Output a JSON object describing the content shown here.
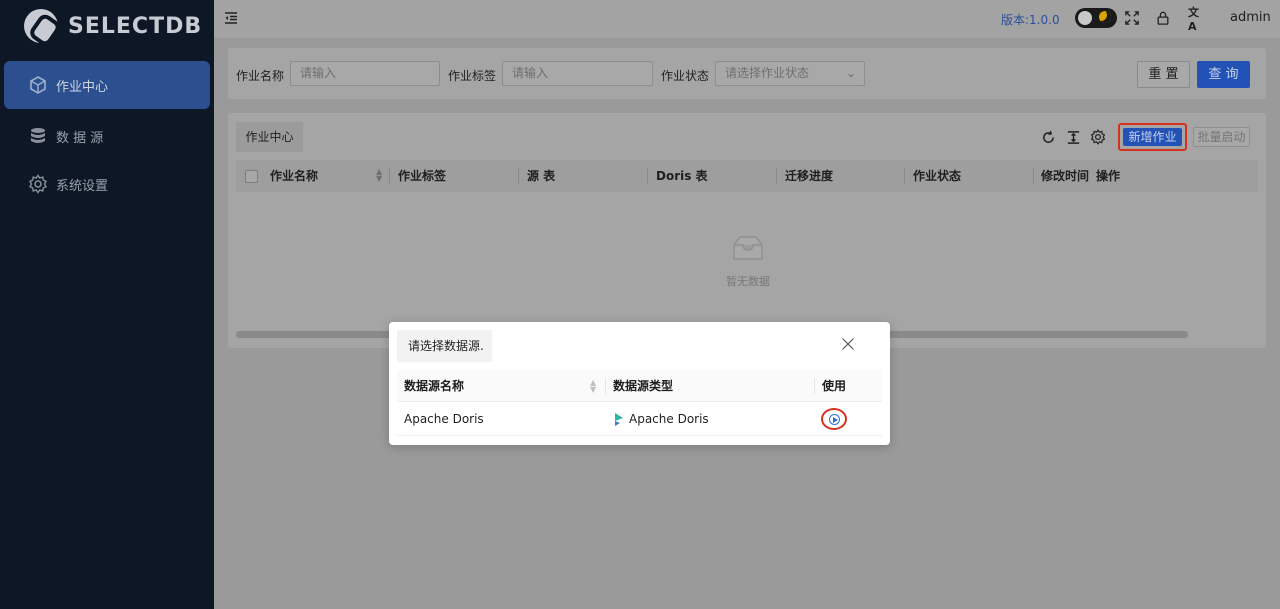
{
  "sidebar": {
    "brand": "SELECTDB",
    "items": [
      {
        "label": "作业中心",
        "icon": "cube-icon",
        "active": true
      },
      {
        "label": "数 据 源",
        "icon": "database-icon",
        "active": false
      },
      {
        "label": "系统设置",
        "icon": "gear-icon",
        "active": false
      }
    ]
  },
  "header": {
    "version": "版本:1.0.0",
    "user": "admin",
    "translate_glyph": "文A"
  },
  "search": {
    "job_name_label": "作业名称",
    "job_name_placeholder": "请输入",
    "job_tag_label": "作业标签",
    "job_tag_placeholder": "请输入",
    "job_status_label": "作业状态",
    "job_status_placeholder": "请选择作业状态",
    "reset_label": "重 置",
    "query_label": "查 询"
  },
  "main": {
    "tab_label": "作业中心",
    "new_job_label": "新增作业",
    "batch_start_label": "批量启动",
    "columns": [
      "作业名称",
      "作业标签",
      "源 表",
      "Doris 表",
      "迁移进度",
      "作业状态",
      "修改时间",
      "操作"
    ],
    "empty_text": "暂无数据"
  },
  "modal": {
    "title": "请选择数据源.",
    "columns": [
      "数据源名称",
      "数据源类型",
      "使用"
    ],
    "rows": [
      {
        "name": "Apache Doris",
        "type": "Apache Doris"
      }
    ]
  },
  "colors": {
    "primary": "#2252b6",
    "highlight": "#d4321f",
    "sidebar_bg": "#0d1726"
  }
}
